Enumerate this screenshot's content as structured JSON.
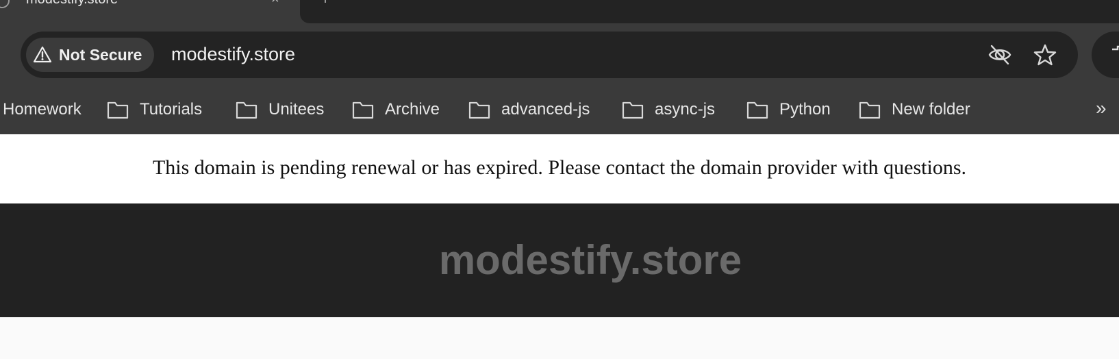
{
  "tab": {
    "title": "modestify.store",
    "close_glyph": "×"
  },
  "address_bar": {
    "security_label": "Not Secure",
    "url": "modestify.store"
  },
  "bookmarks": {
    "items": [
      {
        "label": "Homework",
        "icon": "none"
      },
      {
        "label": "Tutorials",
        "icon": "folder-icon"
      },
      {
        "label": "Unitees",
        "icon": "folder-icon"
      },
      {
        "label": "Archive",
        "icon": "folder-icon"
      },
      {
        "label": "advanced-js",
        "icon": "folder-icon"
      },
      {
        "label": "async-js",
        "icon": "folder-icon"
      },
      {
        "label": "Python",
        "icon": "folder-icon"
      },
      {
        "label": "New folder",
        "icon": "folder-icon"
      }
    ],
    "overflow_glyph": "»"
  },
  "page": {
    "notice": "This domain is pending renewal or has expired. Please contact the domain provider with questions.",
    "banner_title": "modestify.store"
  },
  "colors": {
    "chrome": "#3a3a3a",
    "omnibox": "#232323",
    "banner_bg": "#222222",
    "banner_text": "#6a6a6a"
  }
}
